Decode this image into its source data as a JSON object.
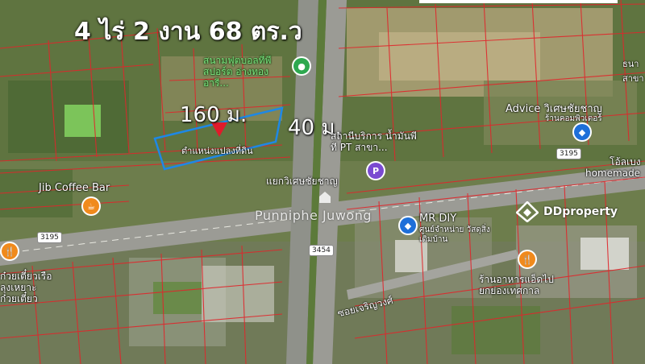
{
  "title": "4 ไร่ 2 งาน 68 ตร.ว",
  "dimensions": {
    "length": "160 ม.",
    "width": "40 ม."
  },
  "plot_label": "ตำแหน่งแปลงที่ดิน",
  "places": {
    "football_field": "สนามฟุตบอลที่พี สปอร์ต อ่างทอง อารี...",
    "advice": "Advice วิเศษชัยชาญ",
    "advice_sub": "ร้านคอมพิวเตอร์",
    "gas_station": "สถานีบริการ น้ำมันพีที PT สาขา...",
    "junction": "แยกวิเศษชัยชาญ",
    "jib": "Jib Coffee Bar",
    "mrdiy": "MR DIY",
    "mrdiy_sub": "ศูนย์จำหน่าย วัสดุสิ่งเดิมบ้าน",
    "homemade": "homemade",
    "restaurant": "ร้านอาหารแอ็ดไป ยกย่องเทศกาล",
    "noodle": "ก๋วยเตี๋ยวเรือ ลุงเหยาะ ก๋วยเตี๋ยว",
    "soi": "ซอยเจริญวงศ์",
    "bank": "ธนา สาขา",
    "right_edge": "โอ้ลเบง"
  },
  "routes": {
    "r1": "3195",
    "r2": "3195",
    "r3": "3454"
  },
  "watermark": "Punniphe Juwong",
  "brand": "DDproperty",
  "colors": {
    "parcel_line": "#e0262b",
    "plot_outline": "#1e88e5",
    "marker": "#e01b2a"
  },
  "icons": [
    "map-pin-icon",
    "coffee-icon",
    "store-icon",
    "restaurant-icon",
    "gas-station-icon",
    "park-icon",
    "ddproperty-logo-icon"
  ]
}
